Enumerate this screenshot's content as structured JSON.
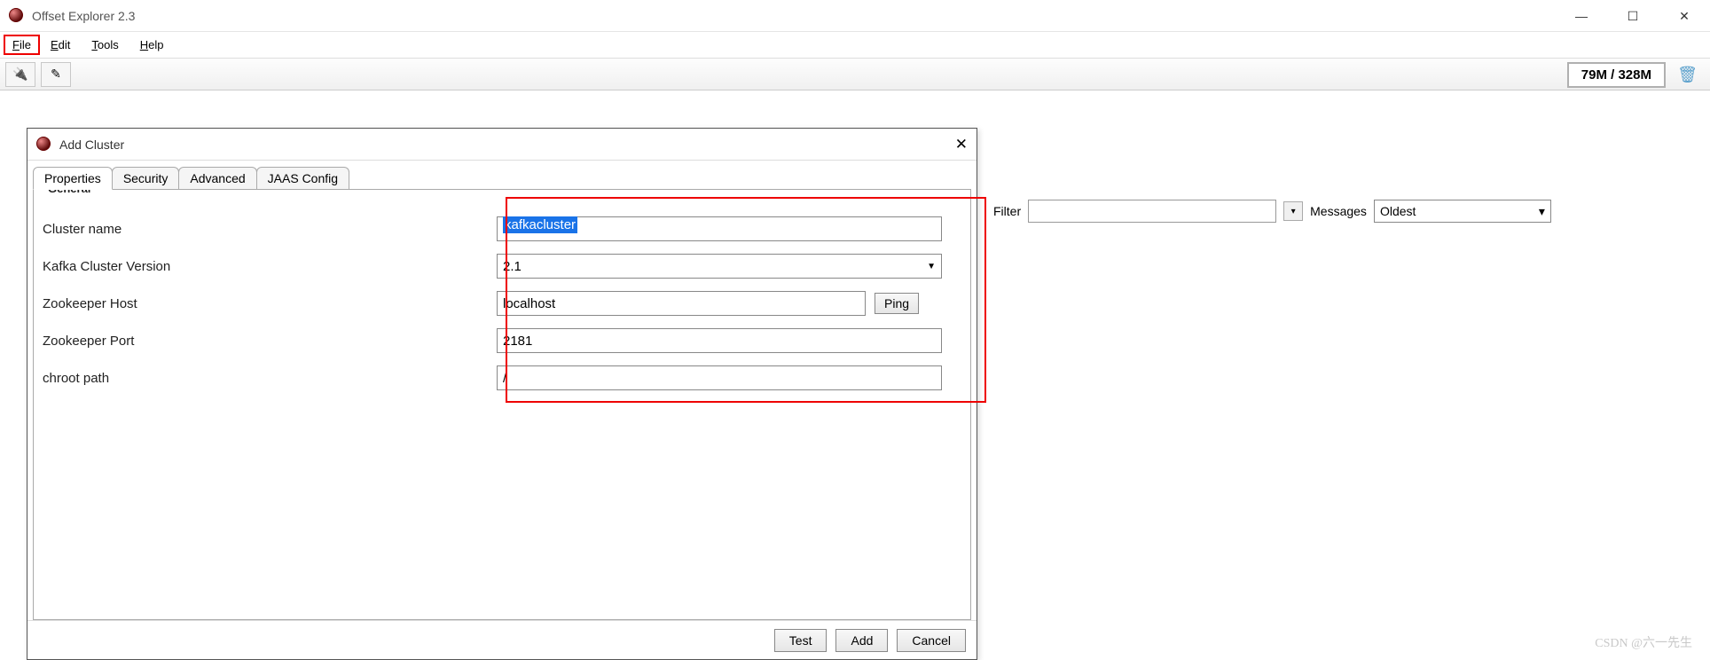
{
  "app": {
    "title": "Offset Explorer  2.3",
    "memory_status": "79M / 328M"
  },
  "menubar": {
    "file": "File",
    "edit": "Edit",
    "tools": "Tools",
    "help": "Help"
  },
  "filter_row": {
    "filter_label": "Filter",
    "messages_label": "Messages",
    "messages_selected": "Oldest"
  },
  "dialog": {
    "title": "Add Cluster",
    "tabs": {
      "properties": "Properties",
      "security": "Security",
      "advanced": "Advanced",
      "jaas": "JAAS Config"
    },
    "fieldset": "General",
    "labels": {
      "cluster_name": "Cluster name",
      "kafka_version": "Kafka Cluster Version",
      "zk_host": "Zookeeper Host",
      "zk_port": "Zookeeper Port",
      "chroot": "chroot path"
    },
    "values": {
      "cluster_name": "kafkacluster",
      "kafka_version": "2.1",
      "zk_host": "localhost",
      "zk_port": "2181",
      "chroot": "/"
    },
    "buttons": {
      "ping": "Ping",
      "test": "Test",
      "add": "Add",
      "cancel": "Cancel"
    }
  },
  "watermark": "CSDN @六一先生"
}
